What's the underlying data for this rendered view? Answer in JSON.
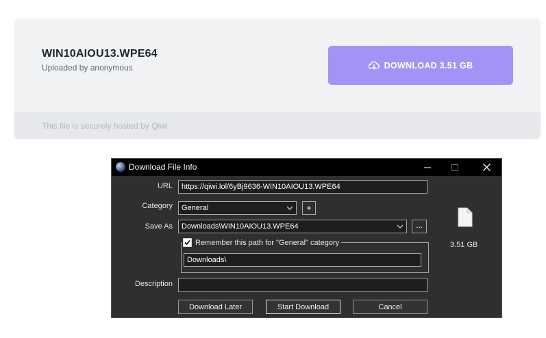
{
  "page": {
    "file_name": "WIN10AIOU13.WPE64",
    "uploader": "Uploaded by anonymous",
    "download_button": "DOWNLOAD 3.51 GB",
    "hosted_note": "This file is securely hosted by Qiwi",
    "accent_color": "#a393f6"
  },
  "dialog": {
    "title": "Download File Info",
    "url_label": "URL",
    "url_value": "https://qiwi.lol/6yBj9636-WIN10AIOU13.WPE64",
    "category_label": "Category",
    "category_value": "General",
    "add_category": "+",
    "save_as_label": "Save As",
    "save_as_value": "Downloads\\WIN10AIOU13.WPE64",
    "browse": "...",
    "remember_label": "Remember this path for \"General\" category",
    "remember_path": "Downloads\\",
    "description_label": "Description",
    "description_value": "",
    "file_size": "3.51  GB",
    "buttons": {
      "later": "Download Later",
      "start": "Start Download",
      "cancel": "Cancel"
    }
  }
}
